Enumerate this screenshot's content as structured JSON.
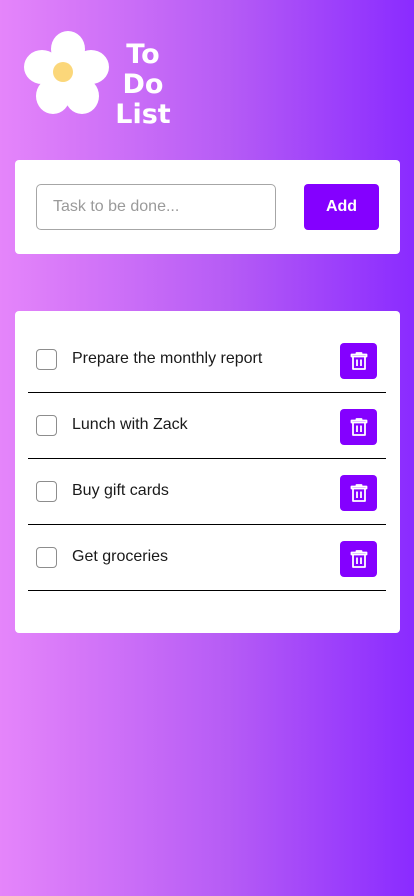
{
  "header": {
    "title_line1": "To Do",
    "title_line2": "List",
    "logo_icon": "flower-icon"
  },
  "form": {
    "placeholder": "Task to be done...",
    "value": "",
    "add_label": "Add"
  },
  "tasks": [
    {
      "label": "Prepare the monthly report",
      "checked": false
    },
    {
      "label": "Lunch with Zack",
      "checked": false
    },
    {
      "label": "Buy gift cards",
      "checked": false
    },
    {
      "label": "Get groceries",
      "checked": false
    }
  ],
  "icons": {
    "delete": "trash-icon"
  },
  "colors": {
    "accent": "#8400ff",
    "gradient_start": "#e585fa",
    "gradient_end": "#8a2bff",
    "flower_petal": "#ffffff",
    "flower_center": "#fbd77a"
  }
}
